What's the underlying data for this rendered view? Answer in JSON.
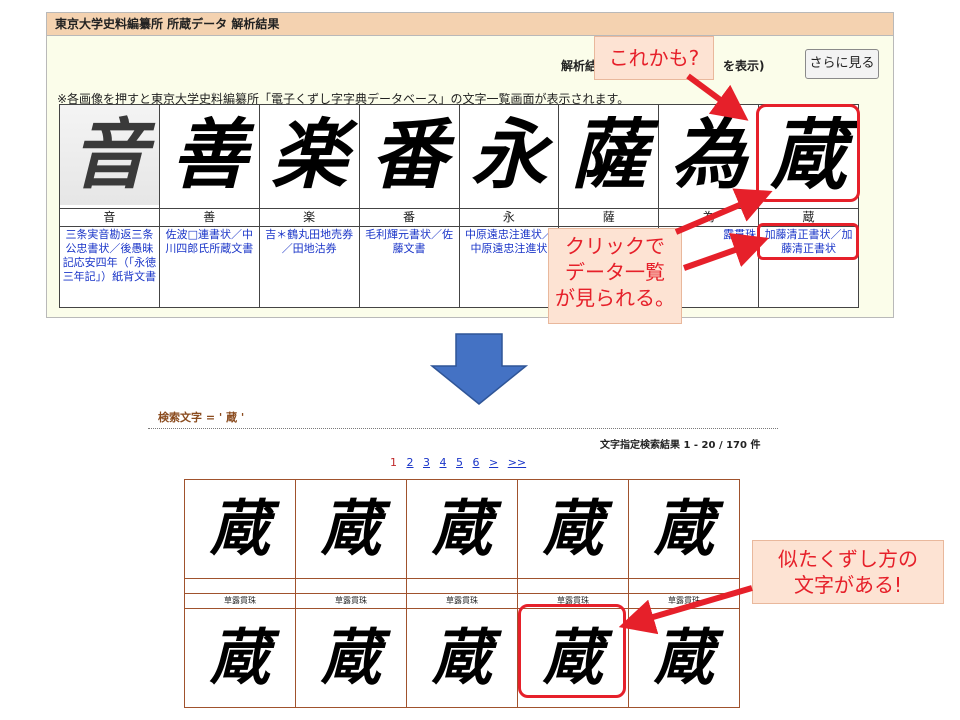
{
  "panel": {
    "title": "東京大学史料編纂所 所蔵データ 解析結果",
    "result_label": "解析結",
    "show_label": "を表示)",
    "more_button": "さらに見る",
    "note": "※各画像を押すと東京大学史料編纂所「電子くずし字字典データベース」の文字一覧画面が表示されます。",
    "characters": [
      {
        "glyph": "音",
        "name": "音",
        "doc": "三条実音勘返三条公忠書状／後愚昧記応安四年（「永徳三年記」）紙背文書"
      },
      {
        "glyph": "善",
        "name": "善",
        "doc": "佐波□連書状／中川四郎氏所蔵文書"
      },
      {
        "glyph": "楽",
        "name": "楽",
        "doc": "吉＊鶴丸田地売券／田地沽券"
      },
      {
        "glyph": "番",
        "name": "番",
        "doc": "毛利輝元書状／佐藤文書"
      },
      {
        "glyph": "永",
        "name": "永",
        "doc": "中原遠忠注進状／中原遠忠注進状"
      },
      {
        "glyph": "薩",
        "name": "薩",
        "doc": ""
      },
      {
        "glyph": "為",
        "name": "為",
        "doc": "露貫珠"
      },
      {
        "glyph": "蔵",
        "name": "蔵",
        "doc": "加藤清正書状／加藤清正書状"
      }
    ]
  },
  "results": {
    "search_label": "検索文字 = ' 蔵 '",
    "count_label": "文字指定検索結果 1 - 20 / 170 件",
    "pager": [
      "1",
      "2",
      "3",
      "4",
      "5",
      "6",
      ">",
      ">>"
    ],
    "row1": [
      {
        "glyph": "蔵",
        "name": ""
      },
      {
        "glyph": "蔵",
        "name": ""
      },
      {
        "glyph": "蔵",
        "name": ""
      },
      {
        "glyph": "蔵",
        "name": ""
      },
      {
        "glyph": "蔵",
        "name": ""
      }
    ],
    "row1_names": [
      "草露貫珠",
      "草露貫珠",
      "草露貫珠",
      "草露貫珠",
      "草露貫珠"
    ],
    "row2": [
      {
        "glyph": "蔵"
      },
      {
        "glyph": "蔵"
      },
      {
        "glyph": "蔵"
      },
      {
        "glyph": "蔵"
      },
      {
        "glyph": "蔵"
      }
    ]
  },
  "annotations": {
    "callout_top": "これかも?",
    "callout_click": [
      "クリックで",
      "データ一覧",
      "が見られる。"
    ],
    "callout_similar": [
      "似たくずし方の",
      "文字がある!"
    ]
  },
  "colors": {
    "accent_red": "#e6202a",
    "callout_bg": "#fde3d3",
    "panel_bg": "#fbfdea",
    "title_bg": "#f4d2b0",
    "flow_arrow": "#4472c4"
  }
}
